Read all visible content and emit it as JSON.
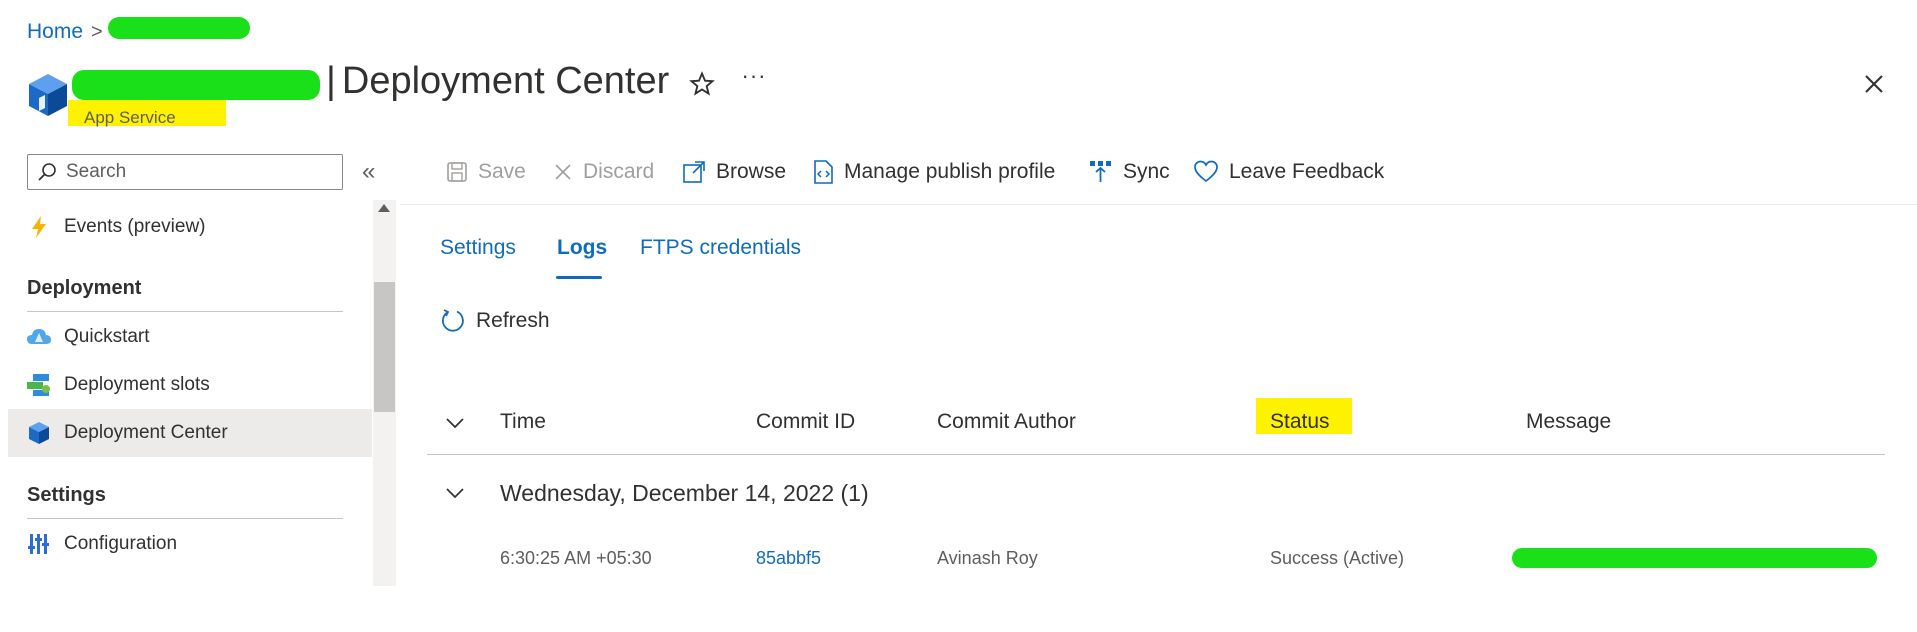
{
  "breadcrumb": {
    "home": "Home",
    "separator": ">"
  },
  "page": {
    "title_suffix": "Deployment Center",
    "subtitle": "App Service",
    "close_label": "×",
    "more_label": "···"
  },
  "sidebar": {
    "search_placeholder": "Search",
    "collapse_label": "«",
    "items": [
      {
        "label": "Events (preview)",
        "icon": "lightning-icon"
      },
      {
        "label": "Quickstart",
        "icon": "cloud-icon"
      },
      {
        "label": "Deployment slots",
        "icon": "slots-icon"
      },
      {
        "label": "Deployment Center",
        "icon": "cube-icon"
      },
      {
        "label": "Configuration",
        "icon": "sliders-icon"
      }
    ],
    "sections": [
      "Deployment",
      "Settings"
    ]
  },
  "toolbar": {
    "save": "Save",
    "discard": "Discard",
    "browse": "Browse",
    "manage_publish_profile": "Manage publish profile",
    "sync": "Sync",
    "leave_feedback": "Leave Feedback"
  },
  "tabs": [
    "Settings",
    "Logs",
    "FTPS credentials"
  ],
  "active_tab": "Logs",
  "refresh_label": "Refresh",
  "table": {
    "columns": [
      "Time",
      "Commit ID",
      "Commit Author",
      "Status",
      "Message"
    ],
    "group": {
      "title": "Wednesday, December 14, 2022 (1)"
    },
    "rows": [
      {
        "time": "6:30:25 AM +05:30",
        "commit_id": "85abbf5",
        "author": "Avinash Roy",
        "status": "Success (Active)"
      }
    ]
  },
  "colors": {
    "accent": "#0f6cbd",
    "selected_bg": "#edebe9",
    "highlight": "#fff200",
    "redaction": "#19e019"
  }
}
